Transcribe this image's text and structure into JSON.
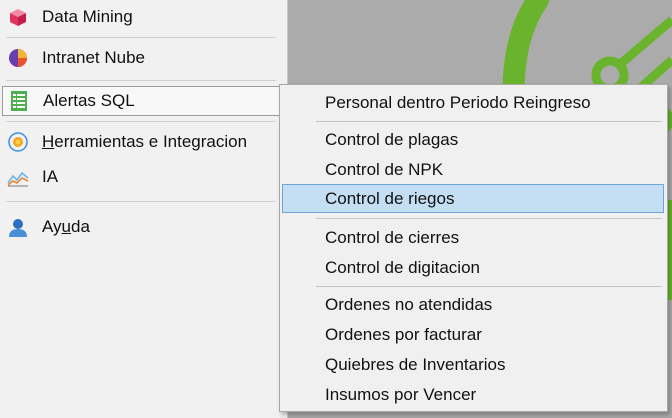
{
  "main_menu": {
    "items": [
      {
        "label_pre": "",
        "label_u": "",
        "label_post": "Data Mining",
        "icon": "cube-icon"
      },
      {
        "label_pre": "",
        "label_u": "",
        "label_post": "Intranet Nube",
        "icon": "pie-chart-icon"
      },
      {
        "label_pre": "",
        "label_u": "",
        "label_post": "Alertas SQL",
        "icon": "list-icon"
      },
      {
        "label_pre": "",
        "label_u": "H",
        "label_post": "erramientas e Integracion",
        "icon": "sun-icon"
      },
      {
        "label_pre": "",
        "label_u": "",
        "label_post": "IA",
        "icon": "line-chart-icon"
      },
      {
        "label_pre": "Ay",
        "label_u": "u",
        "label_post": "da",
        "icon": "user-icon"
      }
    ]
  },
  "submenu": {
    "items": [
      "Personal dentro Periodo Reingreso",
      "Control de plagas",
      "Control de NPK",
      "Control de riegos",
      "Control de cierres",
      "Control de digitacion",
      "Ordenes no atendidas",
      "Ordenes por facturar",
      "Quiebres de Inventarios",
      "Insumos por Vencer"
    ],
    "selected": "Control de riegos"
  },
  "colors": {
    "background": "#ababab",
    "accent_green": "#6ab42d",
    "selection": "#c4def4"
  }
}
